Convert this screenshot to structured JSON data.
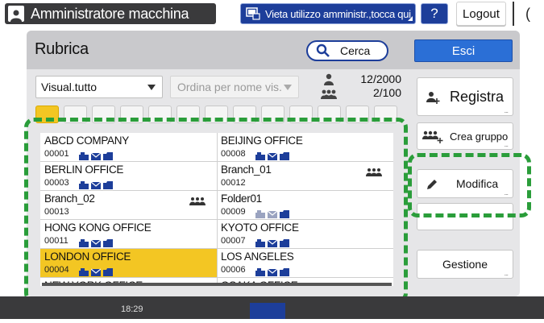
{
  "topbar": {
    "admin_title": "Amministratore macchina",
    "restriction_notice": "Vieta utilizzo amministr.,tocca qui",
    "help_label": "?",
    "logout_label": "Logout",
    "night_label": "("
  },
  "header": {
    "title": "Rubrica",
    "search_label": "Cerca",
    "exit_label": "Esci"
  },
  "filters": {
    "view_selected": "Visual.tutto",
    "order_placeholder": "Ordina per nome vis."
  },
  "counts": {
    "users": "12/2000",
    "groups": "2/100"
  },
  "side": {
    "register_label": "Registra",
    "create_group_label": "Crea gruppo",
    "edit_label": "Modifica",
    "manage_label": "Gestione",
    "more_dots": "..."
  },
  "entries": [
    {
      "name": "ABCD COMPANY",
      "number": "00001",
      "type": "user",
      "methods": [
        "fax",
        "mail",
        "folder"
      ],
      "selected": false
    },
    {
      "name": "BEIJING OFFICE",
      "number": "00008",
      "type": "user",
      "methods": [
        "fax",
        "mail",
        "folder"
      ],
      "selected": false
    },
    {
      "name": "BERLIN OFFICE",
      "number": "00003",
      "type": "user",
      "methods": [
        "fax",
        "mail",
        "folder"
      ],
      "selected": false
    },
    {
      "name": "Branch_01",
      "number": "00012",
      "type": "group",
      "methods": [],
      "selected": false
    },
    {
      "name": "Branch_02",
      "number": "00013",
      "type": "group",
      "methods": [],
      "selected": false
    },
    {
      "name": "Folder01",
      "number": "00009",
      "type": "user",
      "methods": [
        "fax-grey",
        "mail-grey",
        "folder"
      ],
      "selected": false
    },
    {
      "name": "HONG KONG OFFICE",
      "number": "00011",
      "type": "user",
      "methods": [
        "fax",
        "mail",
        "folder"
      ],
      "selected": false
    },
    {
      "name": "KYOTO OFFICE",
      "number": "00007",
      "type": "user",
      "methods": [
        "fax",
        "mail",
        "folder"
      ],
      "selected": false
    },
    {
      "name": "LONDON OFFICE",
      "number": "00004",
      "type": "user",
      "methods": [
        "fax",
        "mail",
        "folder"
      ],
      "selected": true
    },
    {
      "name": "LOS ANGELES",
      "number": "00006",
      "type": "user",
      "methods": [
        "fax",
        "mail",
        "folder"
      ],
      "selected": false
    },
    {
      "name": "NEW YORK OFFICE",
      "number": "",
      "type": "user",
      "methods": [],
      "selected": false
    },
    {
      "name": "OSAKA OFFICE",
      "number": "",
      "type": "user",
      "methods": [],
      "selected": false
    }
  ],
  "statusbar": {
    "time": "18:29"
  },
  "colors": {
    "accent_blue": "#1d3e9a",
    "exit_blue": "#2b6fd6",
    "selected_yellow": "#f3c623",
    "highlight_green": "#2a9d3a"
  }
}
